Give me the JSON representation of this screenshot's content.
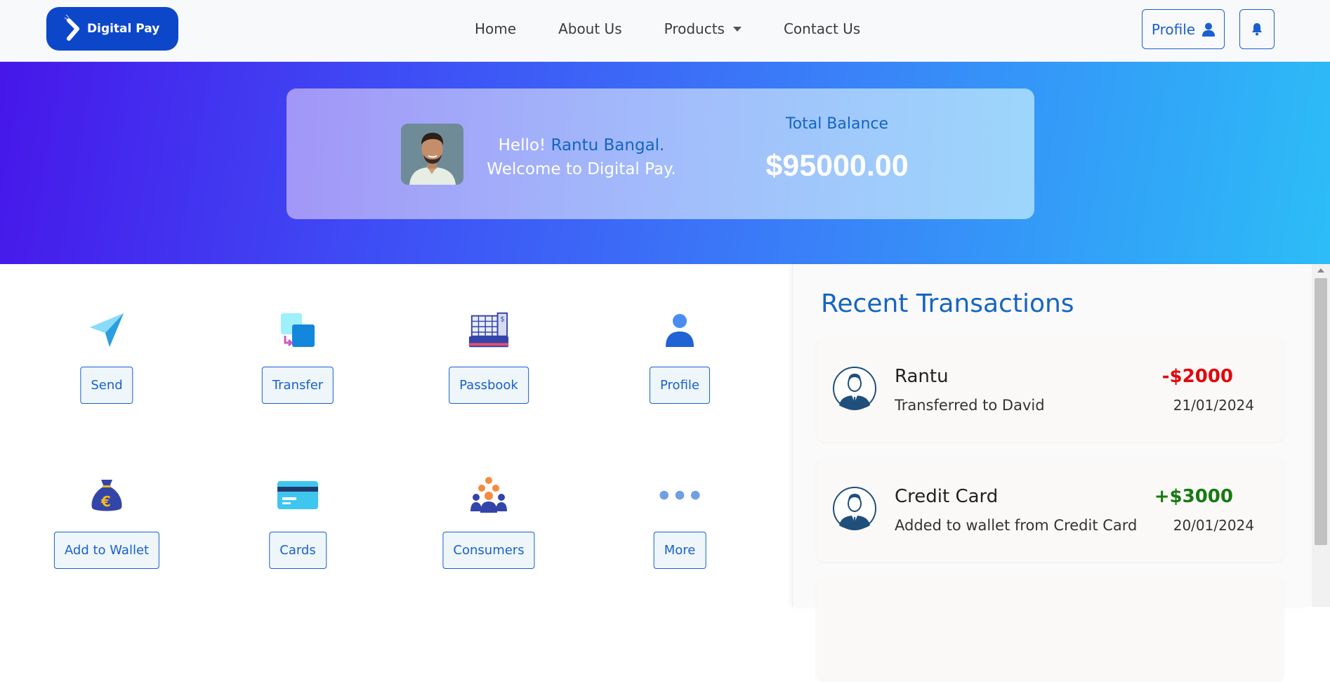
{
  "brand": {
    "name": "Digital Pay",
    "icon": "arrow-logo-icon",
    "color": "#0d47c9"
  },
  "nav": {
    "items": [
      {
        "label": "Home"
      },
      {
        "label": "About Us"
      },
      {
        "label": "Products"
      },
      {
        "label": "Contact Us"
      }
    ],
    "profile_label": "Profile",
    "profile_icon": "user-icon",
    "bell_icon": "bell-icon"
  },
  "hero": {
    "greeting_prefix": "Hello!",
    "user_name": "Rantu Bangal.",
    "welcome_line": "Welcome to Digital Pay.",
    "balance_label": "Total Balance",
    "balance_value": "$95000.00"
  },
  "services": [
    {
      "label": "Send",
      "icon": "paper-plane-icon"
    },
    {
      "label": "Transfer",
      "icon": "transfer-icon"
    },
    {
      "label": "Passbook",
      "icon": "cash-register-icon"
    },
    {
      "label": "Profile",
      "icon": "user-icon"
    },
    {
      "label": "Add to Wallet",
      "icon": "money-bag-icon"
    },
    {
      "label": "Cards",
      "icon": "credit-card-icon"
    },
    {
      "label": "Consumers",
      "icon": "group-icon"
    },
    {
      "label": "More",
      "icon": "more-dots-icon"
    }
  ],
  "recent": {
    "title": "Recent Transactions",
    "transactions": [
      {
        "name": "Rantu",
        "description": "Transferred to David",
        "amount": "-$2000",
        "date": "21/01/2024",
        "amount_color": "#e3070d"
      },
      {
        "name": "Credit Card",
        "description": "Added to wallet from Credit Card",
        "amount": "+$3000",
        "date": "20/01/2024",
        "amount_color": "#157a12"
      }
    ]
  },
  "colors": {
    "accent": "#1565c0",
    "button_border": "#1a5fd0",
    "debit": "#e3070d",
    "credit": "#157a12"
  }
}
